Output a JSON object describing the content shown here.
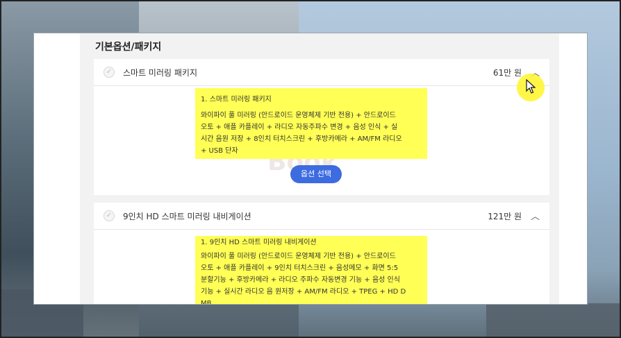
{
  "section": {
    "title": "기본옵션/패키지"
  },
  "cards": [
    {
      "name": "스마트 미러링 패키지",
      "price": "61만 원",
      "detail_title": "1. 스마트 미러링 패키지",
      "detail_lines": [
        "와이파이 풀 미러링 (안드로이드 운영체제 기반 전용) + 안드로이드",
        "오토 + 애플 카플레이 + 라디오 자동주파수 변경 + 음성 인식 + 실",
        "시간 음원 저장 + 8인치 터치스크린 + 후방카메라 + AM/FM 라디오",
        "+ USB 단자"
      ],
      "button": "옵션 선택"
    },
    {
      "name": "9인치 HD 스마트 미러링 내비게이션",
      "price": "121만 원",
      "detail_title": "1. 9인치 HD 스마트 미러링 내비게이션",
      "detail_lines": [
        "와이파이 풀 미러링 (안드로이드 운영체제 기반 전용) + 안드로이드",
        "오토 + 애플 카플레이 + 9인치 터치스크린 + 음성메모 + 화면 5:5",
        "분할기능 + 후방카메라 + 라디오 주파수 자동변경 기능 + 음성 인식",
        "기능 + 실시간 라디오 음 원저장 + AM/FM 라디오 + TPEG + HD D",
        "MB"
      ]
    }
  ],
  "icons": {
    "check": "check-circle-icon",
    "chevron": "chevron-up-icon",
    "cursor": "mouse-pointer-icon"
  },
  "colors": {
    "highlight": "#ffff55",
    "button": "#3d6be0",
    "cursor_highlight": "#fff528"
  }
}
